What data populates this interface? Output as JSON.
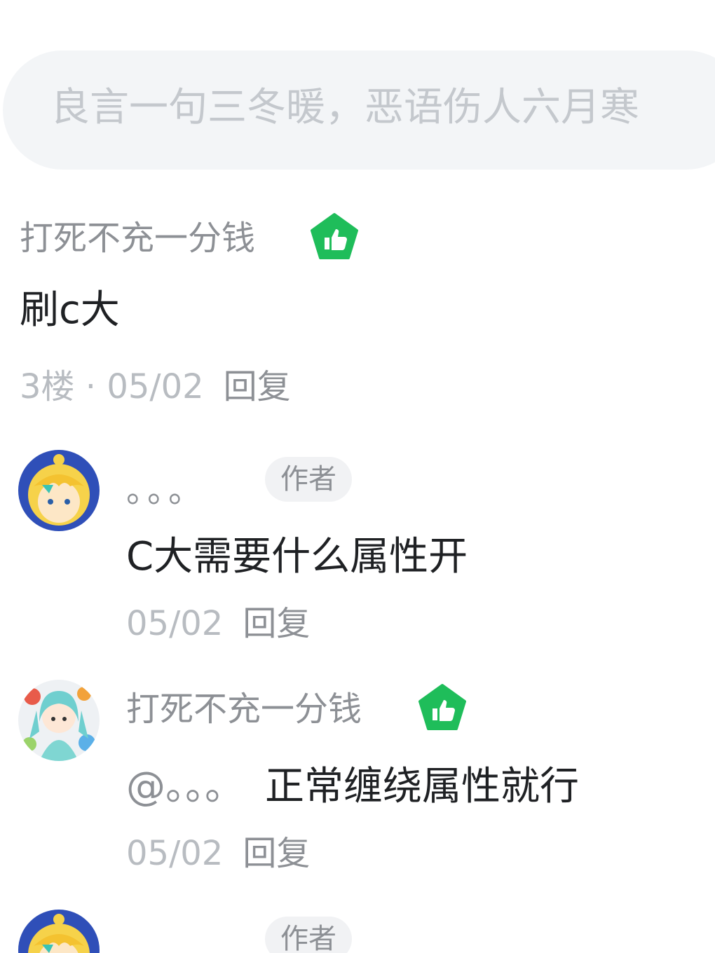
{
  "input": {
    "placeholder": "良言一句三冬暖，恶语伤人六月寒"
  },
  "floor_comment": {
    "username": "打死不充一分钱",
    "badge_icon": "green-thumb-badge-icon",
    "content": "刷c大",
    "meta": "3楼 · 05/02",
    "reply_label": "回复"
  },
  "replies": [
    {
      "username": "。。。",
      "tag": "作者",
      "content": "C大需要什么属性开",
      "date": "05/02",
      "reply_label": "回复"
    },
    {
      "username": "打死不充一分钱",
      "badge_icon": "green-thumb-badge-icon",
      "mention": "@。。。",
      "content": "正常缠绕属性就行",
      "date": "05/02",
      "reply_label": "回复"
    },
    {
      "username": "。。。",
      "tag": "作者"
    }
  ],
  "colors": {
    "badge_green": "#1fbd5a",
    "input_bg": "#f3f5f7"
  }
}
